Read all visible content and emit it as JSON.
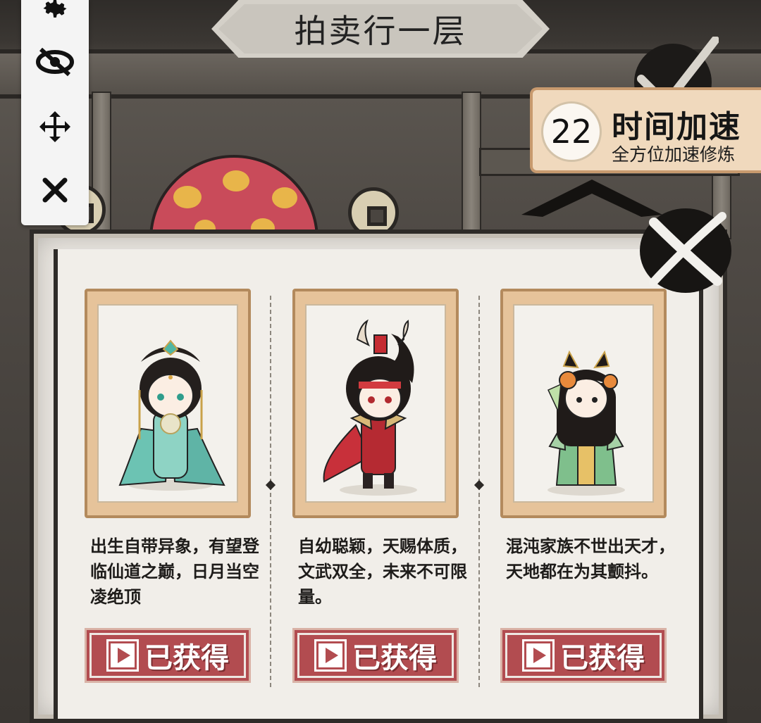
{
  "header": {
    "title": "拍卖行一层"
  },
  "toolbar": {
    "items": [
      {
        "icon": "gear-icon"
      },
      {
        "icon": "eye-off-icon"
      },
      {
        "icon": "move-arrows-icon"
      },
      {
        "icon": "close-icon"
      }
    ]
  },
  "speed_boost": {
    "count": "22",
    "title": "时间加速",
    "subtitle": "全方位加速修炼"
  },
  "panel": {
    "close_icon": "brush-x-icon",
    "cards": [
      {
        "character": "celestial-maiden",
        "description": "出生自带异象，有望登临仙道之巅，日月当空凌绝顶",
        "button_label": "已获得"
      },
      {
        "character": "red-warrior",
        "description": "自幼聪颖，天赐体质，文武双全，未来不可限量。",
        "button_label": "已获得"
      },
      {
        "character": "green-fox-girl",
        "description": "混沌家族不世出天才，天地都在为其颤抖。",
        "button_label": "已获得"
      }
    ]
  },
  "colors": {
    "button_red": "#b24c50",
    "card_frame": "#e6c39a",
    "badge_bg": "#f0d9bd",
    "panel_bg": "#f1eee9"
  }
}
